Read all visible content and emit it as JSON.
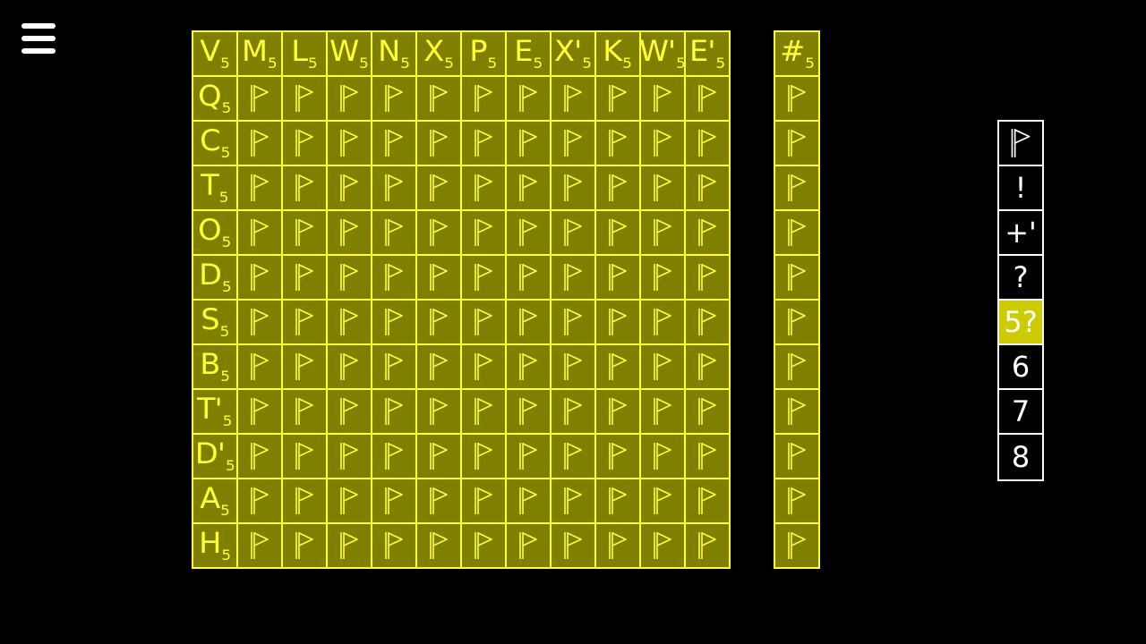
{
  "menu": {
    "icon": "hamburger-menu-icon"
  },
  "colors": {
    "background": "#000000",
    "cell_fill": "#808000",
    "cell_border": "#ffff33",
    "text": "#ffff33",
    "palette_active": "#cccc00"
  },
  "grid": {
    "corner": {
      "main": "V",
      "sub": "5"
    },
    "columns": [
      {
        "main": "M",
        "sub": "5"
      },
      {
        "main": "L",
        "sub": "5"
      },
      {
        "main": "W",
        "sub": "5"
      },
      {
        "main": "N",
        "sub": "5"
      },
      {
        "main": "X",
        "sub": "5"
      },
      {
        "main": "P",
        "sub": "5"
      },
      {
        "main": "E",
        "sub": "5"
      },
      {
        "main": "X'",
        "sub": "5"
      },
      {
        "main": "K",
        "sub": "5"
      },
      {
        "main": "W'",
        "sub": "5"
      },
      {
        "main": "E'",
        "sub": "5"
      }
    ],
    "rows": [
      {
        "main": "Q",
        "sub": "5"
      },
      {
        "main": "C",
        "sub": "5"
      },
      {
        "main": "T",
        "sub": "5"
      },
      {
        "main": "O",
        "sub": "5"
      },
      {
        "main": "D",
        "sub": "5"
      },
      {
        "main": "S",
        "sub": "5"
      },
      {
        "main": "B",
        "sub": "5"
      },
      {
        "main": "T'",
        "sub": "5"
      },
      {
        "main": "D'",
        "sub": "5"
      },
      {
        "main": "A",
        "sub": "5"
      },
      {
        "main": "H",
        "sub": "5"
      }
    ],
    "cell_icon": "flag-icon"
  },
  "count_column": {
    "header": {
      "main": "#",
      "sub": "5"
    },
    "cell_icon": "flag-icon"
  },
  "palette": {
    "items": [
      {
        "label": "",
        "icon": "flag-icon",
        "active": false
      },
      {
        "label": "!",
        "active": false
      },
      {
        "label": "+'",
        "active": false
      },
      {
        "label": "?",
        "active": false
      },
      {
        "label": "5?",
        "active": true
      },
      {
        "label": "6",
        "active": false
      },
      {
        "label": "7",
        "active": false
      },
      {
        "label": "8",
        "active": false
      }
    ]
  }
}
